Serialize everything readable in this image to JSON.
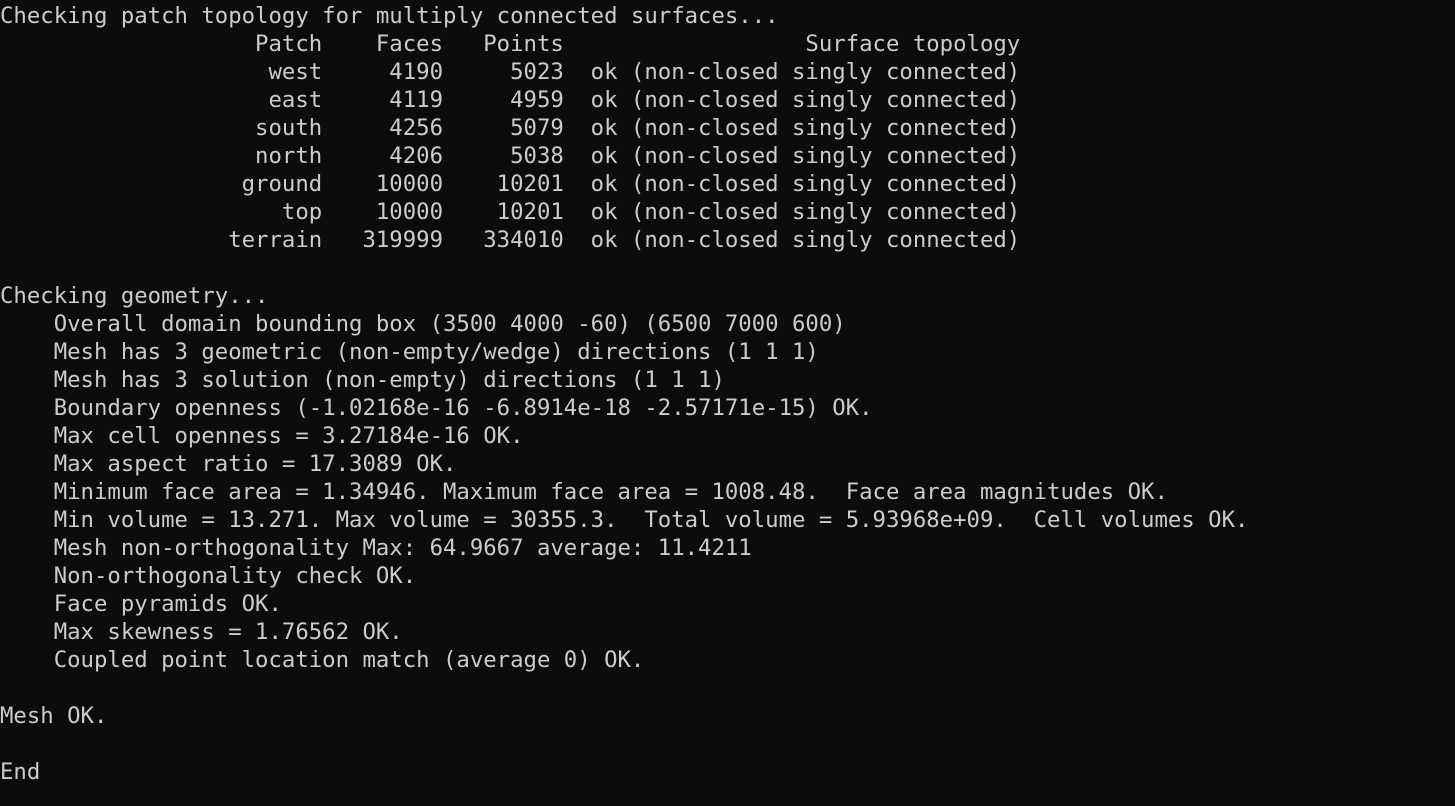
{
  "console": {
    "lines": [
      "Checking patch topology for multiply connected surfaces...",
      "                   Patch    Faces   Points                  Surface topology",
      "                    west     4190     5023  ok (non-closed singly connected)",
      "                    east     4119     4959  ok (non-closed singly connected)",
      "                   south     4256     5079  ok (non-closed singly connected)",
      "                   north     4206     5038  ok (non-closed singly connected)",
      "                  ground    10000    10201  ok (non-closed singly connected)",
      "                     top    10000    10201  ok (non-closed singly connected)",
      "                 terrain   319999   334010  ok (non-closed singly connected)",
      "",
      "Checking geometry...",
      "    Overall domain bounding box (3500 4000 -60) (6500 7000 600)",
      "    Mesh has 3 geometric (non-empty/wedge) directions (1 1 1)",
      "    Mesh has 3 solution (non-empty) directions (1 1 1)",
      "    Boundary openness (-1.02168e-16 -6.8914e-18 -2.57171e-15) OK.",
      "    Max cell openness = 3.27184e-16 OK.",
      "    Max aspect ratio = 17.3089 OK.",
      "    Minimum face area = 1.34946. Maximum face area = 1008.48.  Face area magnitudes OK.",
      "    Min volume = 13.271. Max volume = 30355.3.  Total volume = 5.93968e+09.  Cell volumes OK.",
      "    Mesh non-orthogonality Max: 64.9667 average: 11.4211",
      "    Non-orthogonality check OK.",
      "    Face pyramids OK.",
      "    Max skewness = 1.76562 OK.",
      "    Coupled point location match (average 0) OK.",
      "",
      "Mesh OK.",
      "",
      "End"
    ]
  }
}
